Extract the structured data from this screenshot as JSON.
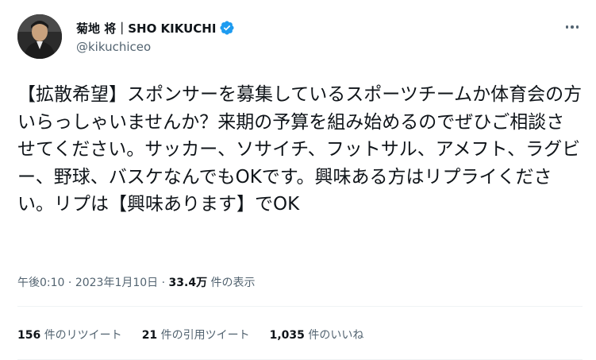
{
  "author": {
    "display_name": "菊地 将｜SHO KIKUCHI",
    "handle": "@kikuchiceo",
    "verified": true,
    "verified_color": "#1d9bf0"
  },
  "tweet": {
    "text": "【拡散希望】スポンサーを募集しているスポーツチームか体育会の方いらっしゃいませんか？来期の予算を組み始めるのでぜひご相談させてください。サッカー、ソサイチ、フットサル、アメフト、ラグビー、野球、バスケなんでもOKです。興味ある方はリプライください。リプは【興味あります】でOK"
  },
  "meta": {
    "time": "午後0:10",
    "separator": "·",
    "date": "2023年1月10日",
    "views_count": "33.4万",
    "views_label": "件の表示"
  },
  "stats": {
    "retweets_count": "156",
    "retweets_label": "件のリツイート",
    "quotes_count": "21",
    "quotes_label": "件の引用ツイート",
    "likes_count": "1,035",
    "likes_label": "件のいいね"
  },
  "icons": {
    "more": "more-horizontal-icon",
    "verified": "verified-badge-icon"
  }
}
